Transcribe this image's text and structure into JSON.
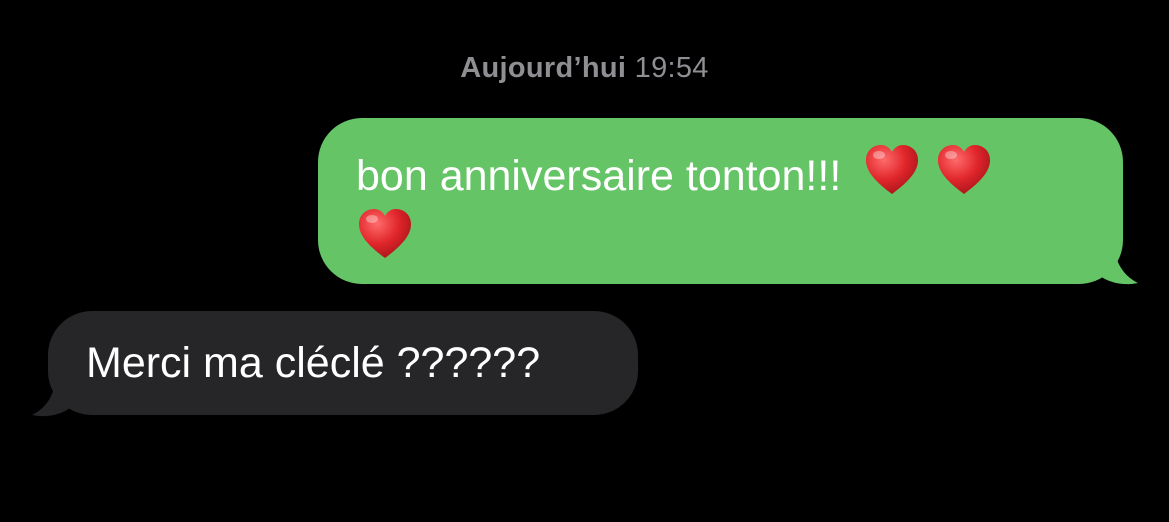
{
  "timestamp": {
    "day": "Aujourd’hui",
    "time": "19:54"
  },
  "messages": [
    {
      "direction": "sent",
      "text": "bon anniversaire tonton!!!",
      "emoji": [
        "red-heart",
        "red-heart",
        "red-heart"
      ]
    },
    {
      "direction": "received",
      "text": "Merci ma cléclé ??????"
    }
  ],
  "colors": {
    "background": "#000000",
    "sent_bubble": "#65c466",
    "received_bubble": "#262628",
    "timestamp": "#8e8e93",
    "heart": "#e0262b"
  }
}
